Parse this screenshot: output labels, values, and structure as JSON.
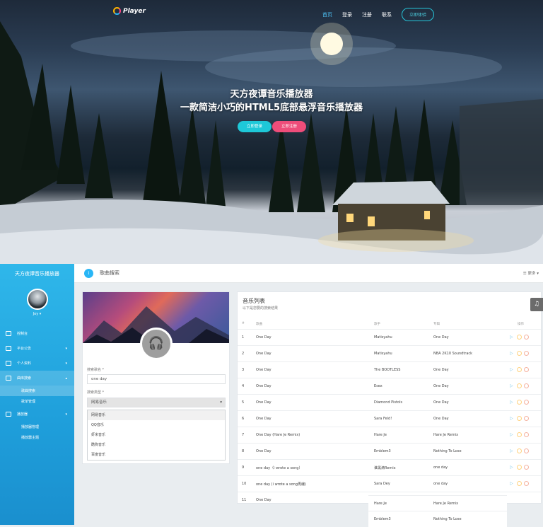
{
  "nav": {
    "logo_text": "Player",
    "items": [
      "首页",
      "登录",
      "注册",
      "联系"
    ],
    "register_button": "立即体验"
  },
  "hero": {
    "title_line1": "天方夜谭音乐播放器",
    "title_line2": "一款简洁小巧的HTML5底部悬浮音乐播放器",
    "button_primary": "立即登录",
    "button_secondary": "立即注册"
  },
  "sidebar": {
    "title": "天方夜谭音乐播放器",
    "user": "Joy ▾",
    "items": [
      {
        "label": "控制台"
      },
      {
        "label": "平台公告"
      },
      {
        "label": "个人资料"
      },
      {
        "label": "曲库搜索"
      },
      {
        "label": "歌曲搜索"
      },
      {
        "label": "歌单管理"
      },
      {
        "label": "播放器"
      },
      {
        "label": "播放器管理"
      },
      {
        "label": "播放器主题"
      }
    ]
  },
  "topbar": {
    "icon_text": "i",
    "title": "歌曲搜索",
    "more": "更多 ▾"
  },
  "search_form": {
    "keyword_label": "搜索歌名 *",
    "keyword_value": "one day",
    "source_label": "搜索类型 *",
    "source_value": "网易音乐",
    "options": [
      "网易音乐",
      "QQ音乐",
      "虾米音乐",
      "酷狗音乐",
      "百度音乐"
    ],
    "selected_option": "网易音乐"
  },
  "results": {
    "title": "音乐列表",
    "subtitle": "以下是您要的搜索结果",
    "columns": [
      "#",
      "歌曲",
      "歌手",
      "专辑",
      "操作"
    ],
    "rows": [
      [
        "1",
        "One Day",
        "Matisyahu",
        "One Day"
      ],
      [
        "2",
        "One Day",
        "Matisyahu",
        "NBA 2K10 Soundtrack"
      ],
      [
        "3",
        "One Day",
        "The BOOTLESS",
        "One Day"
      ],
      [
        "4",
        "One Day",
        "Esex",
        "One Day"
      ],
      [
        "5",
        "One Day",
        "Diamond Pistols",
        "One Day"
      ],
      [
        "6",
        "One Day",
        "Sara Feld!",
        "One Day"
      ],
      [
        "7",
        "One Day (Hare Je Remix)",
        "Hare Je",
        "Hare Je Remix"
      ],
      [
        "8",
        "One Day",
        "Emblem3",
        "Nothing To Lose"
      ],
      [
        "9",
        "one day（i wrote a song）",
        "谁黑滴Remix",
        "one day"
      ],
      [
        "10",
        "one day (i wrote a song再编)",
        "Sara Dey",
        "one day"
      ],
      [
        "11",
        "One Day",
        "",
        ""
      ]
    ],
    "overflow_rows": [
      [
        "Hare Je",
        "Hare Je Remix"
      ],
      [
        "Emblem3",
        "Nothing To Lose"
      ]
    ]
  },
  "side_tab": "♫"
}
